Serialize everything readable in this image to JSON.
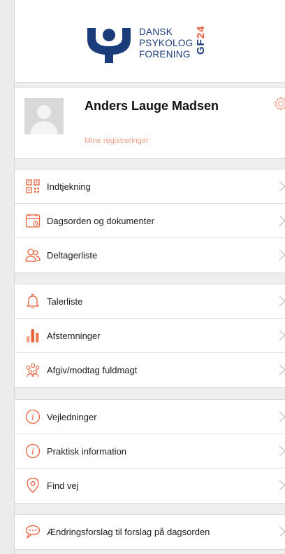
{
  "logo": {
    "line1": "DANSK",
    "line2": "PSYKOLOG",
    "line3": "FORENING",
    "gf": "GF",
    "gf_num": "24",
    "brand_color": "#1a3c7a",
    "accent_color": "#e8613a"
  },
  "profile": {
    "name": "Anders Lauge Madsen",
    "link": "Mine registreringer",
    "settings_icon": "gear-icon"
  },
  "groups": [
    {
      "items": [
        {
          "label": "Indtjekning",
          "icon": "qr-code-icon"
        },
        {
          "label": "Dagsorden og dokumenter",
          "icon": "calendar-icon"
        },
        {
          "label": "Deltagerliste",
          "icon": "people-icon"
        }
      ]
    },
    {
      "items": [
        {
          "label": "Talerliste",
          "icon": "bell-icon"
        },
        {
          "label": "Afstemninger",
          "icon": "bar-chart-icon"
        },
        {
          "label": "Afgiv/modtag fuldmagt",
          "icon": "group-icon"
        }
      ]
    },
    {
      "items": [
        {
          "label": "Vejledninger",
          "icon": "info-icon"
        },
        {
          "label": "Praktisk information",
          "icon": "info-icon"
        },
        {
          "label": "Find vej",
          "icon": "location-pin-icon"
        }
      ]
    },
    {
      "items": [
        {
          "label": "Ændringsforslag til forslag på dagsorden",
          "icon": "speech-bubble-icon"
        }
      ]
    }
  ]
}
